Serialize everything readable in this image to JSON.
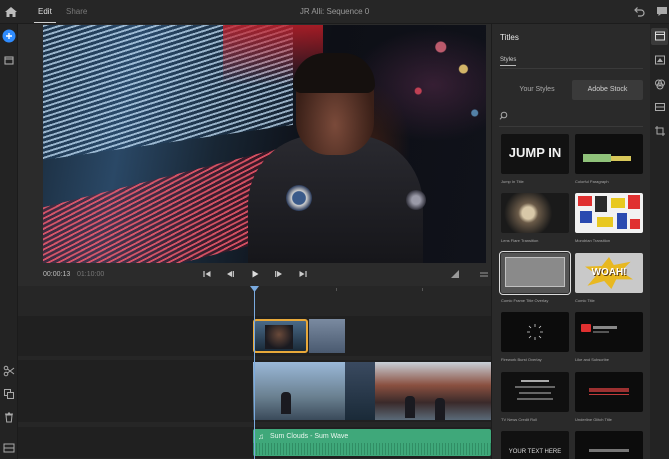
{
  "window": {
    "title": "JR Alli: Sequence 0"
  },
  "tabs": {
    "edit": "Edit",
    "share": "Share"
  },
  "viewer": {
    "timecode": "00:00:13",
    "duration": "01:10:00"
  },
  "timeline": {
    "audio_clip_label": "Sum Clouds - Sum Wave",
    "audio_glyph": "♫"
  },
  "titles_panel": {
    "heading": "Titles",
    "subtab": "Styles",
    "segment_left": "Your Styles",
    "segment_right": "Adobe Stock",
    "items": [
      {
        "caption": "Jump In Title",
        "thumb_text": "JUMP IN"
      },
      {
        "caption": "Colorful Paragraph",
        "thumb_text": ""
      },
      {
        "caption": "Lens Flare Transition",
        "thumb_text": ""
      },
      {
        "caption": "Mondrian Transition",
        "thumb_text": ""
      },
      {
        "caption": "Comic Frame Title Overlay",
        "thumb_text": ""
      },
      {
        "caption": "Comic Title",
        "thumb_text": "WOAH!"
      },
      {
        "caption": "Firework Burst Overlay",
        "thumb_text": ""
      },
      {
        "caption": "Like and Subscribe",
        "thumb_text": ""
      },
      {
        "caption": "TV News Credit Roll",
        "thumb_text": ""
      },
      {
        "caption": "Underline Glitch Title",
        "thumb_text": ""
      },
      {
        "caption": "",
        "thumb_text": "YOUR TEXT HERE"
      },
      {
        "caption": "",
        "thumb_text": ""
      }
    ]
  },
  "colors": {
    "accent_selection": "#e8a93a",
    "audio_track": "#3fa87a",
    "playhead": "#7aaadf",
    "add_button": "#2f8cff"
  }
}
